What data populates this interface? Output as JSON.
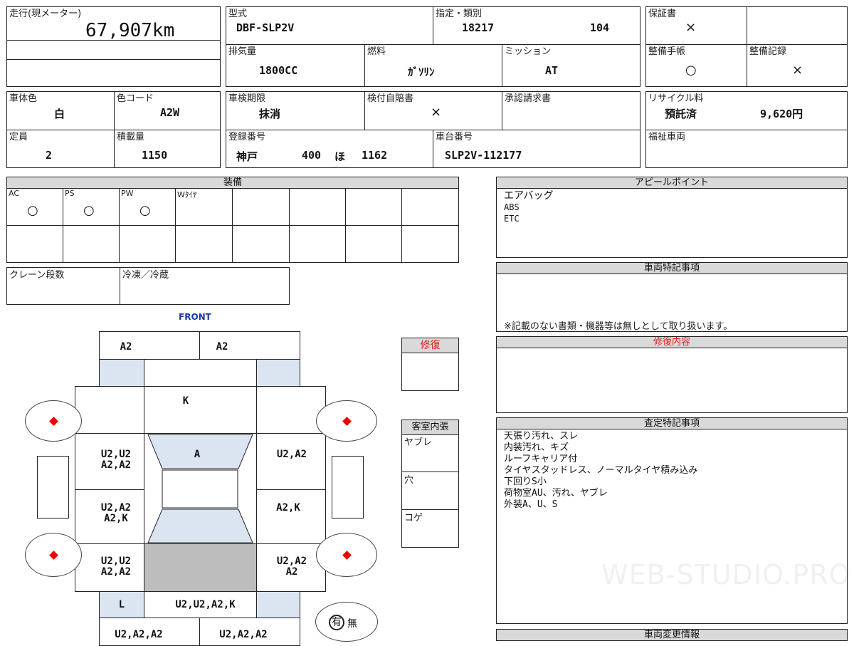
{
  "mileage": {
    "label": "走行(現メーター)",
    "value": "67,907km"
  },
  "model": {
    "label": "型式",
    "value": "DBF-SLP2V"
  },
  "designation": {
    "label": "指定・類別",
    "code1": "18217",
    "code2": "104"
  },
  "warranty": {
    "label": "保証書",
    "value": "×"
  },
  "exhaust": {
    "label": "排気量",
    "value": "1800CC"
  },
  "fuel": {
    "label": "燃料",
    "value": "ｶﾞｿﾘﾝ"
  },
  "transmission": {
    "label": "ミッション",
    "value": "AT"
  },
  "service_book": {
    "label": "整備手帳",
    "value": "○"
  },
  "service_record": {
    "label": "整備記録",
    "value": "×"
  },
  "body_color": {
    "label": "車体色",
    "value": "白"
  },
  "color_code": {
    "label": "色コード",
    "value": "A2W"
  },
  "inspection": {
    "label": "車検期限",
    "value": "抹消"
  },
  "insurance": {
    "label": "検付自賠書",
    "value": "×"
  },
  "approval": {
    "label": "承認請求書",
    "value": ""
  },
  "recycle": {
    "label": "リサイクル料",
    "status": "預託済",
    "amount": "9,620円"
  },
  "capacity": {
    "label": "定員",
    "value": "2"
  },
  "load": {
    "label": "積載量",
    "value": "1150"
  },
  "registration": {
    "label": "登録番号",
    "place": "神戸",
    "class": "400",
    "kana": "ほ",
    "number": "1162"
  },
  "chassis": {
    "label": "車台番号",
    "value": "SLP2V-112177"
  },
  "welfare": {
    "label": "福祉車両",
    "value": ""
  },
  "equipment": {
    "header": "装備",
    "items": [
      {
        "label": "AC",
        "value": "○"
      },
      {
        "label": "PS",
        "value": "○"
      },
      {
        "label": "PW",
        "value": "○"
      },
      {
        "label": "Wﾀｲﾔ",
        "value": ""
      }
    ]
  },
  "crane": {
    "label": "クレーン段数",
    "value": ""
  },
  "refrigeration": {
    "label": "冷凍／冷蔵",
    "value": ""
  },
  "appeal": {
    "header": "アピールポイント",
    "lines": [
      "エアバッグ",
      "ABS",
      "ETC"
    ]
  },
  "special": {
    "header": "車両特記事項",
    "note": "※記載のない書類・機器等は無しとして取り扱います。"
  },
  "repair_details": {
    "header": "修復内容"
  },
  "assessment": {
    "header": "査定特記事項",
    "lines": [
      "天張り汚れ、スレ",
      "内装汚れ、キズ",
      "ルーフキャリア付",
      "タイヤスタッドレス、ノーマルタイヤ積み込み",
      "下回りS小",
      "荷物室AU、汚れ、ヤブレ",
      "外装A、U、S"
    ]
  },
  "change_info": {
    "header": "車両変更情報"
  },
  "repair": {
    "label": "修復",
    "value": ""
  },
  "interior": {
    "header": "客室内張",
    "items": [
      "ヤブレ",
      "穴",
      "コゲ"
    ]
  },
  "diagram": {
    "front_label": "FRONT",
    "marks": {
      "front_left": "A2",
      "front_right": "A2",
      "hood": "K",
      "left_front": "U2,U2\nA2,A2",
      "windshield": "A",
      "right_front": "U2,A2",
      "left_mid": "U2,A2\nA2,K",
      "right_mid": "A2,K",
      "left_rear": "U2,U2\nA2,A2",
      "right_rear": "U2,A2\nA2",
      "rear_left": "L",
      "rear_center": "U2,U2,A2,K",
      "bottom_left": "U2,A2,A2",
      "bottom_right": "U2,A2,A2"
    },
    "yes_label": "有",
    "no_label": "無"
  },
  "watermark": "WEB-STUDIO.PRO"
}
